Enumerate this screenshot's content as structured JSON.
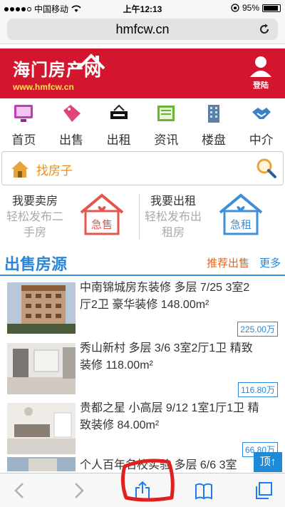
{
  "status_bar": {
    "carrier": "中国移动",
    "time": "上午12:13",
    "battery": "95%"
  },
  "browser": {
    "url": "hmfcw.cn"
  },
  "header": {
    "logo_text": "海门房产网",
    "logo_url": "www.hmfcw.cn",
    "login_label": "登陆"
  },
  "nav": [
    {
      "label": "首页",
      "icon": "monitor-icon"
    },
    {
      "label": "出售",
      "icon": "sale-tag-icon"
    },
    {
      "label": "出租",
      "icon": "rent-sign-icon"
    },
    {
      "label": "资讯",
      "icon": "newspaper-icon"
    },
    {
      "label": "楼盘",
      "icon": "building-icon"
    },
    {
      "label": "中介",
      "icon": "handshake-icon"
    }
  ],
  "search": {
    "placeholder": "找房子"
  },
  "quick": {
    "sell": {
      "line1": "我要卖房",
      "line2": "轻松发布二",
      "line3": "手房",
      "badge": "急售"
    },
    "rent": {
      "line1": "我要出租",
      "line2": "轻松发布出",
      "line3": "租房",
      "badge": "急租"
    }
  },
  "listings_section": {
    "title": "出售房源",
    "recommended": "推荐出售",
    "more": "更多"
  },
  "listings": [
    {
      "title_line1": "中南锦城房东装修 多层 7/25 3室2",
      "title_line2": "厅2卫 豪华装修 148.00m²",
      "price": "225.00万"
    },
    {
      "title_line1": "秀山新村 多层 3/6 3室2厅1卫 精致",
      "title_line2": "装修 118.00m²",
      "price": "116.80万"
    },
    {
      "title_line1": "贵都之星 小高层 9/12 1室1厅1卫 精",
      "title_line2": "致装修 84.00m²",
      "price": "66.80万"
    },
    {
      "title_line1": "个人百年名校实验 多层 6/6 3室"
    }
  ],
  "top_button": "顶↑",
  "colors": {
    "brand_red": "#d3162e",
    "accent_blue": "#2c86d8",
    "accent_orange": "#e8651c",
    "annotation_red": "#e0201f"
  }
}
